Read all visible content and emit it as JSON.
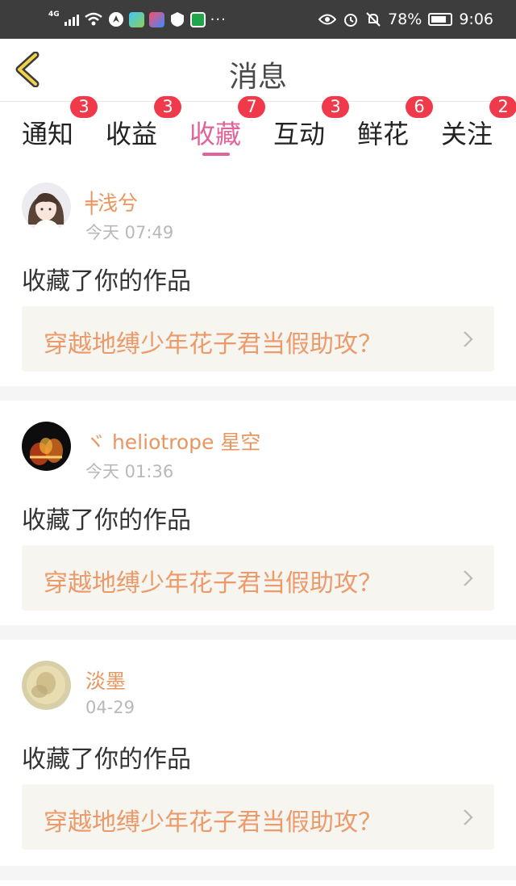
{
  "status_bar": {
    "network": "4G",
    "battery_percent": "78%",
    "time": "9:06",
    "icons": [
      "signal-icon",
      "wifi-icon",
      "app-notification-icons",
      "eye-icon",
      "alarm-icon",
      "mute-icon",
      "battery-icon"
    ]
  },
  "header": {
    "title": "消息",
    "back_icon": "chevron-left-icon"
  },
  "tabs": [
    {
      "label": "通知",
      "badge": "3",
      "active": false
    },
    {
      "label": "收益",
      "badge": "3",
      "active": false
    },
    {
      "label": "收藏",
      "badge": "7",
      "active": true
    },
    {
      "label": "互动",
      "badge": "3",
      "active": false
    },
    {
      "label": "鲜花",
      "badge": "6",
      "active": false
    },
    {
      "label": "关注",
      "badge": "2",
      "active": false
    }
  ],
  "colors": {
    "accent": "#e0649a",
    "badge": "#f0394a",
    "username": "#e8955f",
    "work_title": "#ec9a6a",
    "work_box": "#f6f5f0"
  },
  "messages": [
    {
      "username": "╪浅兮",
      "time": "今天 07:49",
      "action": "收藏了你的作品",
      "work_title": "穿越地缚少年花子君当假助攻？"
    },
    {
      "username": "ヾ heliotrope 星空",
      "time": "今天 01:36",
      "action": "收藏了你的作品",
      "work_title": "穿越地缚少年花子君当假助攻？"
    },
    {
      "username": "淡墨",
      "time": "04-29",
      "action": "收藏了你的作品",
      "work_title": "穿越地缚少年花子君当假助攻？"
    }
  ]
}
